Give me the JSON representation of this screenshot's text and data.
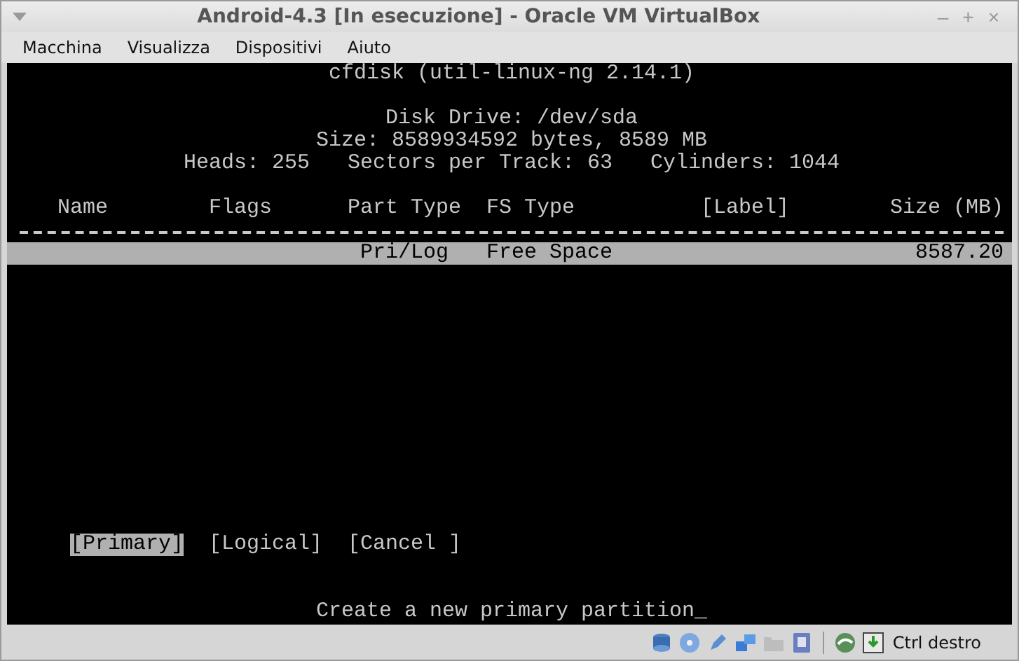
{
  "window": {
    "title": "Android-4.3 [In esecuzione] - Oracle VM VirtualBox",
    "controls": [
      "–",
      "+",
      "×"
    ]
  },
  "menu": [
    "Macchina",
    "Visualizza",
    "Dispositivi",
    "Aiuto"
  ],
  "terminal": {
    "title": "cfdisk (util-linux-ng 2.14.1)",
    "disk_info": [
      "Disk Drive: /dev/sda",
      "Size: 8589934592 bytes, 8589 MB",
      "Heads: 255   Sectors per Track: 63   Cylinders: 1044"
    ],
    "columns": [
      "Name",
      "Flags",
      "Part Type",
      "FS Type",
      "[Label]",
      "Size (MB)"
    ],
    "rows": [
      {
        "part_type": "Pri/Log",
        "fs_type": "Free Space",
        "size": "8587.20",
        "selected": true
      }
    ],
    "buttons": [
      {
        "label": "[Primary]",
        "selected": true
      },
      {
        "label": "[Logical]",
        "selected": false
      },
      {
        "label": "[Cancel ]",
        "selected": false
      }
    ],
    "status": "Create a new primary partition_"
  },
  "status_bar": {
    "host_key": "Ctrl destro"
  }
}
